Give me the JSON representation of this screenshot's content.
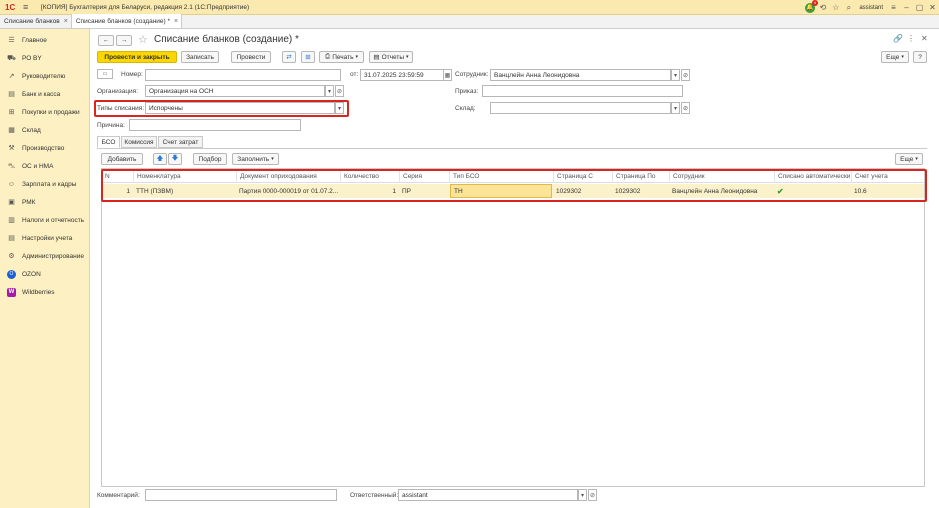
{
  "titlebar": {
    "logo": "1С",
    "title": "[КОПИЯ] Бухгалтерия для Беларуси, редакция 2.1  (1С:Предприятие)",
    "notifications": "4",
    "user": "assistant"
  },
  "tabs": [
    {
      "label": "Списание бланков"
    },
    {
      "label": "Списание бланков (создание) *"
    }
  ],
  "sidebar": {
    "items": [
      {
        "label": "Главное",
        "icon": "menu-icon"
      },
      {
        "label": "РО BY",
        "icon": "shopping-icon"
      },
      {
        "label": "Руководителю",
        "icon": "trend-icon"
      },
      {
        "label": "Банк и касса",
        "icon": "bank-icon"
      },
      {
        "label": "Покупки и продажи",
        "icon": "cart-icon"
      },
      {
        "label": "Склад",
        "icon": "warehouse-icon"
      },
      {
        "label": "Производство",
        "icon": "factory-icon"
      },
      {
        "label": "ОС и НМА",
        "icon": "car-icon"
      },
      {
        "label": "Зарплата и кадры",
        "icon": "people-icon"
      },
      {
        "label": "РМК",
        "icon": "cashier-icon"
      },
      {
        "label": "Налоги и отчетность",
        "icon": "report-icon"
      },
      {
        "label": "Настройки учета",
        "icon": "settings-list-icon"
      },
      {
        "label": "Администрирование",
        "icon": "gear-icon"
      },
      {
        "label": "OZON",
        "icon": "ozon-icon"
      },
      {
        "label": "Wildberries",
        "icon": "wildberries-icon"
      }
    ]
  },
  "form": {
    "title": "Списание бланков (создание) *",
    "more_label": "Еще",
    "help_label": "?",
    "toolbar": {
      "post_close": "Провести и закрыть",
      "save": "Записать",
      "post": "Провести",
      "print": "Печать",
      "reports": "Отчеты"
    },
    "number_label": "Номер:",
    "number_value": "",
    "date_label": "от:",
    "date_value": "31.07.2025 23:59:59",
    "employee_label": "Сотрудник:",
    "employee_value": "Ванцлейн Анна Леонидовна",
    "org_label": "Организация:",
    "org_value": "Организация на ОСН",
    "order_label": "Приказ:",
    "order_value": "",
    "writeoff_type_label": "Типы списания:",
    "writeoff_type_value": "Испорчены",
    "warehouse_label": "Склад:",
    "warehouse_value": "",
    "reason_label": "Причина:",
    "reason_value": "",
    "subtabs": [
      {
        "label": "БСО"
      },
      {
        "label": "Комиссия"
      },
      {
        "label": "Счет затрат"
      }
    ],
    "table_toolbar": {
      "add": "Добавить",
      "pick": "Подбор",
      "fill": "Заполнить",
      "more": "Еще"
    },
    "table": {
      "columns": [
        "N",
        "Номенклатура",
        "Документ оприходования",
        "Количество",
        "Серия",
        "Тип БСО",
        "Страница С",
        "Страница По",
        "Сотрудник",
        "Списано автоматически",
        "Счет учета"
      ],
      "rows": [
        {
          "n": "1",
          "item": "ТТН (ПЗВМ)",
          "doc": "Партия 0000-000019 от 01.07.2...",
          "qty": "1",
          "series": "ПР",
          "type": "ТН",
          "page_from": "1029302",
          "page_to": "1029302",
          "employee": "Ванцлейн Анна Леонидовна",
          "auto": "✔",
          "account": "10.6"
        }
      ]
    },
    "comment_label": "Комментарий:",
    "comment_value": "",
    "responsible_label": "Ответственный:",
    "responsible_value": "assistant"
  },
  "colors": {
    "sidebar_bg": "#fdf0c2",
    "primary_button": "#fbd600",
    "highlight": "#d9251d",
    "row_selected": "#fbf2cc"
  }
}
